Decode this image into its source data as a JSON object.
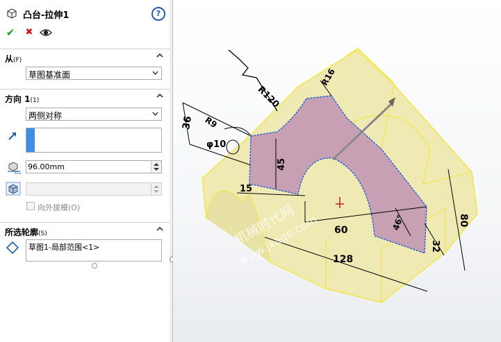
{
  "header": {
    "title": "凸台-拉伸1",
    "help_label": "?"
  },
  "actions": {
    "ok_symbol": "✔",
    "cancel_symbol": "✖",
    "preview_symbol": "👁"
  },
  "from_section": {
    "label": "从",
    "hotkey": "(F)",
    "start_condition": "草图基准面"
  },
  "direction_section": {
    "label": "方向 1",
    "hotkey": "(1)",
    "end_condition": "两侧对称",
    "depth": "96.00mm",
    "draft_outward_label": "向外拔模(O)"
  },
  "contours_section": {
    "label": "所选轮廓",
    "hotkey": "(S)",
    "selected_item": "草图1-局部范围<1>"
  },
  "model": {
    "dims": {
      "r120": "R120",
      "r16": "R16",
      "r9": "R9",
      "phi10": "φ10",
      "d36": "36",
      "d45": "45",
      "d15": "15",
      "d60": "60",
      "d128": "128",
      "d46": "46°",
      "d32": "32",
      "d80": "80"
    },
    "watermark_cn": "机械时代网",
    "watermark_url": "www.jxage.com",
    "colors": {
      "body": "#efe9b4",
      "profile": "#c8a0b4",
      "edge": "#f2e64a",
      "sketch": "#1c5fd6"
    }
  },
  "colors": {
    "ok": "#1f9d1f",
    "cancel": "#d11b1b",
    "accent": "#2a57a8"
  }
}
